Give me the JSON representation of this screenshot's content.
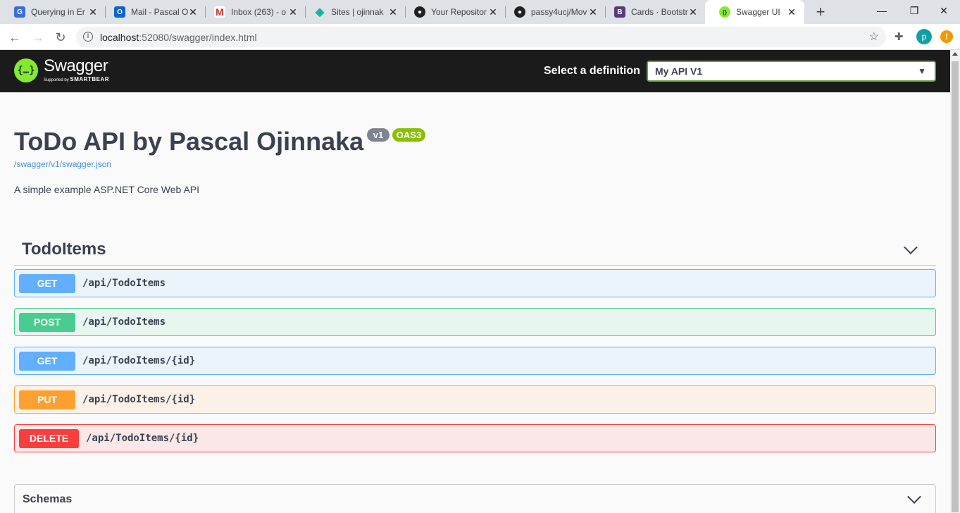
{
  "browser": {
    "tabs": [
      {
        "title": "Querying in Er",
        "icon": "g-app-icon",
        "color": "#3b6fd8"
      },
      {
        "title": "Mail - Pascal O",
        "icon": "outlook-icon",
        "color": "#0a64c9"
      },
      {
        "title": "Inbox (263) - o",
        "icon": "gmail-icon",
        "color": "#d93025"
      },
      {
        "title": "Sites | ojinnak",
        "icon": "diamond-icon",
        "color": "#13b5a5"
      },
      {
        "title": "Your Repositor",
        "icon": "github-icon",
        "color": "#202124"
      },
      {
        "title": "passy4ucj/Mov",
        "icon": "github-icon",
        "color": "#202124"
      },
      {
        "title": "Cards · Bootstr",
        "icon": "bootstrap-icon",
        "color": "#563d7c"
      },
      {
        "title": "Swagger UI",
        "icon": "swagger-icon",
        "color": "#85ea2d"
      }
    ],
    "url_host": "localhost",
    "url_rest": ":52080/swagger/index.html",
    "profile_initial": "p",
    "alert_glyph": "!"
  },
  "swagger": {
    "logo_name": "Swagger",
    "logo_tag_prefix": "Supported by",
    "logo_tag_brand": "SMARTBEAR",
    "definition_label": "Select a definition",
    "definition_value": "My API V1"
  },
  "info": {
    "title": "ToDo API by Pascal Ojinnaka",
    "version_badge": "v1",
    "oas_badge": "OAS3",
    "spec_link": "/swagger/v1/swagger.json",
    "description": "A simple example ASP.NET Core Web API"
  },
  "tag": {
    "name": "TodoItems",
    "operations": [
      {
        "method": "GET",
        "path": "/api/TodoItems"
      },
      {
        "method": "POST",
        "path": "/api/TodoItems"
      },
      {
        "method": "GET",
        "path": "/api/TodoItems/{id}"
      },
      {
        "method": "PUT",
        "path": "/api/TodoItems/{id}"
      },
      {
        "method": "DELETE",
        "path": "/api/TodoItems/{id}"
      }
    ]
  },
  "schemas": {
    "label": "Schemas"
  }
}
